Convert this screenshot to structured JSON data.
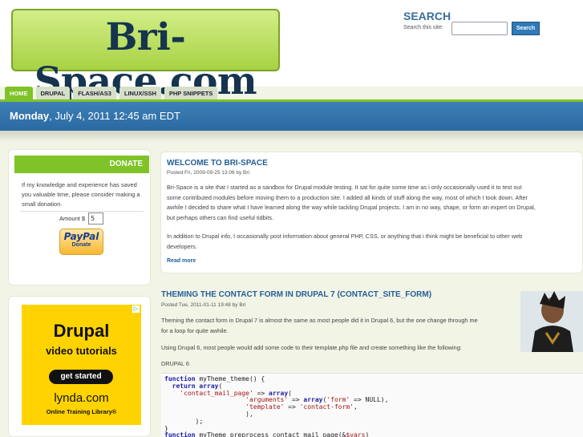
{
  "header": {
    "logo_text": "Bri-Space.com",
    "search_title": "SEARCH",
    "search_label": "Search this site:",
    "search_input_value": "",
    "search_button": "Search"
  },
  "nav": {
    "tabs": [
      "HOME",
      "DRUPAL",
      "FLASH/AS3",
      "LINUX/SSH",
      "PHP SNIPPETS"
    ],
    "active_tab": "HOME"
  },
  "datebar": {
    "day": "Monday",
    "date": ", July 4, 2011 12:45 am EDT"
  },
  "sidebar": {
    "donate": {
      "heading": "DONATE",
      "text": "If my knowledge and experience has saved you valuable time, please consider making a small donation.",
      "amount_label": "Amount $",
      "amount_value": "5",
      "paypal_word": "PayPal",
      "paypal_sub": "Donate"
    },
    "ad": {
      "title": "Drupal",
      "subtitle": "video tutorials",
      "button": "get started",
      "brand": "lynda.com",
      "tagline": "Online Training Library®"
    }
  },
  "posts": [
    {
      "title": "WELCOME TO BRI-SPACE",
      "meta": "Posted Fri, 2009-09-25 13:06 by Bri",
      "body": [
        "Bri-Space is a site that I started as a sandbox for Drupal module testing. It sat for quite some time as i only occasionally used it to test out",
        "some contributed modules before moving them to a production site. I added all kinds of stuff along the way, most of which I took down. After",
        "awhile I decided to share what I have learned along the way while tackling Drupal projects. I am in no way, shape, or form an expert on Drupal,",
        "but perhaps others can find useful tidbits."
      ],
      "body2": [
        "In addition to Drupal info, I occasionally post information about general PHP, CSS, or anything that i think might be beneficial to other web",
        "developers."
      ],
      "readmore": "Read more"
    },
    {
      "title": "THEMING THE CONTACT FORM IN DRUPAL 7 (CONTACT_SITE_FORM)",
      "meta": "Posted Tue, 2011-01-11 19:48 by Bri",
      "body": [
        "Theming the contact form in Drupal 7 is almost the same as most people did it in Drupal 6, but the one change through me",
        "for a loop for quite awhile."
      ],
      "body2": "Using Drupal 6, most people would add some code to their template.php file and create something like the following:",
      "section_label": "DRUPAL 6",
      "code": [
        "function myTheme_theme() {",
        "  return array(",
        "    'contact_mail_page' => array(",
        "                     'arguments' => array('form' => NULL),",
        "                     'template' => 'contact-form',",
        "                     ),",
        "        );",
        "}",
        "function myTheme_preprocess_contact_mail_page(&$vars)"
      ]
    }
  ]
}
